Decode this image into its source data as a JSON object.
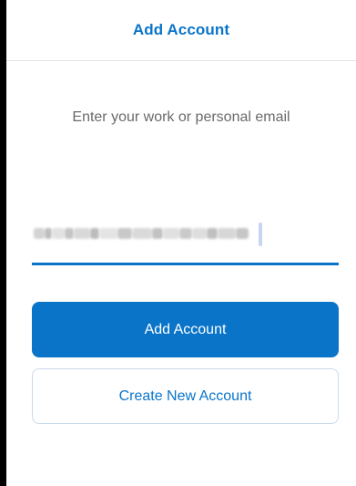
{
  "navbar": {
    "title": "Add Account"
  },
  "prompt": "Enter your work or personal email",
  "email_field": {
    "value_redacted": true
  },
  "buttons": {
    "primary_label": "Add Account",
    "secondary_label": "Create New Account"
  },
  "colors": {
    "accent": "#0a74c9",
    "background": "#ffffff",
    "prompt_text": "#6a6a6a"
  }
}
